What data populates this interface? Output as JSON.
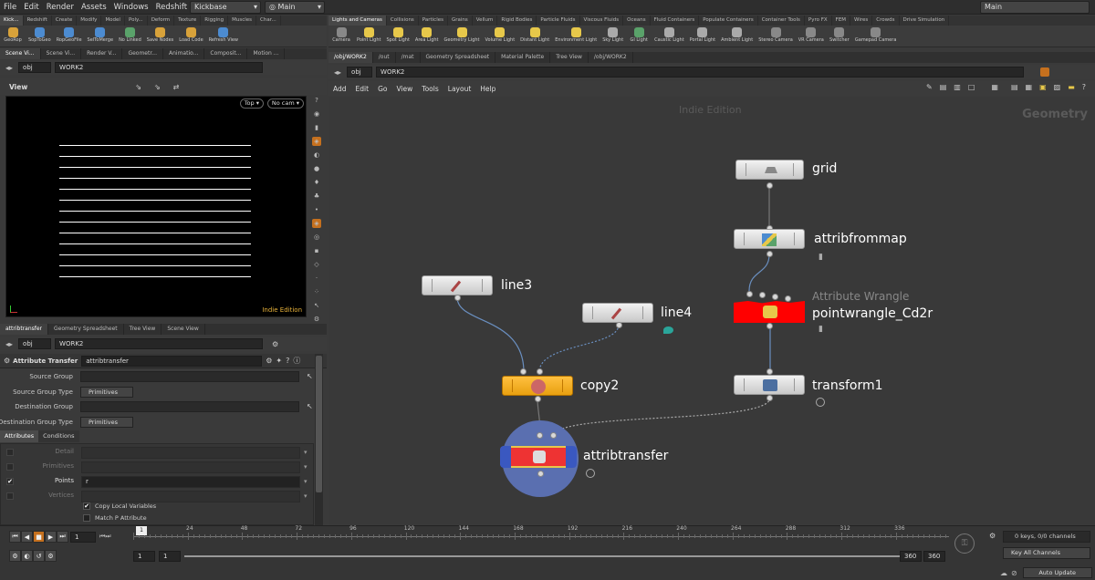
{
  "menu": [
    "File",
    "Edit",
    "Render",
    "Assets",
    "Windows",
    "Redshift",
    "Help"
  ],
  "desktop_left": "Kickbase",
  "desktop_right": "Main",
  "desktop_far": "Main",
  "shelf_left": {
    "tabs": [
      "Kick...",
      "Redshift",
      "Create",
      "Modify",
      "Model",
      "Poly...",
      "Deform",
      "Texture",
      "Rigging",
      "Muscles",
      "Char..."
    ],
    "tools": [
      {
        "label": "GeoRop",
        "color": "#d8a23a"
      },
      {
        "label": "SopToGeo",
        "color": "#4c8bd0"
      },
      {
        "label": "RopGeoFile",
        "color": "#4c8bd0"
      },
      {
        "label": "SelToMerge",
        "color": "#4c8bd0"
      },
      {
        "label": "No Linked",
        "color": "#5aa26a"
      },
      {
        "label": "Save Nodes",
        "color": "#d8a23a"
      },
      {
        "label": "Load Code",
        "color": "#d8a23a"
      },
      {
        "label": "Refresh View",
        "color": "#4c8bd0"
      }
    ]
  },
  "shelf_right": {
    "tabs": [
      "Lights and Cameras",
      "Collisions",
      "Particles",
      "Grains",
      "Vellum",
      "Rigid Bodies",
      "Particle Fluids",
      "Viscous Fluids",
      "Oceans",
      "Fluid Containers",
      "Populate Containers",
      "Container Tools",
      "Pyro FX",
      "FEM",
      "Wires",
      "Crowds",
      "Drive Simulation"
    ],
    "tools": [
      {
        "label": "Camera",
        "color": "#888"
      },
      {
        "label": "Point Light",
        "color": "#e7c84a"
      },
      {
        "label": "Spot Light",
        "color": "#e7c84a"
      },
      {
        "label": "Area Light",
        "color": "#e7c84a"
      },
      {
        "label": "Geometry Light",
        "color": "#e7c84a"
      },
      {
        "label": "Volume Light",
        "color": "#e7c84a"
      },
      {
        "label": "Distant Light",
        "color": "#e7c84a"
      },
      {
        "label": "Environment Light",
        "color": "#e7c84a"
      },
      {
        "label": "Sky Light",
        "color": "#aaa"
      },
      {
        "label": "GI Light",
        "color": "#5aa26a"
      },
      {
        "label": "Caustic Light",
        "color": "#aaa"
      },
      {
        "label": "Portal Light",
        "color": "#aaa"
      },
      {
        "label": "Ambient Light",
        "color": "#aaa"
      },
      {
        "label": "Stereo Camera",
        "color": "#888"
      },
      {
        "label": "VR Camera",
        "color": "#888"
      },
      {
        "label": "Switcher",
        "color": "#888"
      },
      {
        "label": "Gamepad Camera",
        "color": "#888"
      }
    ]
  },
  "viewer": {
    "tabs": [
      "Scene Vi...",
      "Scene Vi...",
      "Render V...",
      "Geometr...",
      "Animatio...",
      "Composit...",
      "Motion ..."
    ],
    "path_obj": "obj",
    "path_net": "WORK2",
    "title": "View",
    "view_mode": "Top",
    "camera": "No cam",
    "watermark": "Indie Edition",
    "lines": 13
  },
  "params": {
    "tabs": [
      "attribtransfer",
      "Geometry Spreadsheet",
      "Tree View",
      "Scene View"
    ],
    "path_obj": "obj",
    "path_net": "WORK2",
    "node_type": "Attribute Transfer",
    "node_name": "attribtransfer",
    "rows": [
      {
        "label": "Source Group",
        "value": ""
      },
      {
        "label": "Source Group Type",
        "value": "Primitives"
      },
      {
        "label": "Destination Group",
        "value": ""
      },
      {
        "label": "Destination Group Type",
        "value": "Primitives"
      }
    ],
    "subtabs": [
      "Attributes",
      "Conditions"
    ],
    "attribs": [
      {
        "label": "Detail",
        "value": "",
        "checked": false
      },
      {
        "label": "Primitives",
        "value": "",
        "checked": false
      },
      {
        "label": "Points",
        "value": "r",
        "checked": true
      },
      {
        "label": "Vertices",
        "value": "",
        "checked": false
      }
    ],
    "copy_local": "Copy Local Variables",
    "match_p": "Match P Attribute"
  },
  "network": {
    "tabs": [
      "/obj/WORK2",
      "/out",
      "/mat",
      "Geometry Spreadsheet",
      "Material Palette",
      "Tree View",
      "/obj/WORK2"
    ],
    "path_obj": "obj",
    "path_net": "WORK2",
    "menu": [
      "Add",
      "Edit",
      "Go",
      "View",
      "Tools",
      "Layout",
      "Help"
    ],
    "watermark": "Indie Edition",
    "context": "Geometry",
    "nodes": {
      "grid": "grid",
      "attribfrommap": "attribfrommap",
      "wrangle_type": "Attribute Wrangle",
      "wrangle": "pointwrangle_Cd2r",
      "transform": "transform1",
      "line3": "line3",
      "line4": "line4",
      "copy": "copy2",
      "attribtransfer": "attribtransfer"
    }
  },
  "timeline": {
    "frame": "1",
    "marker": "1",
    "ticks": [
      "24",
      "48",
      "72",
      "96",
      "120",
      "144",
      "168",
      "192",
      "216",
      "240",
      "264",
      "288",
      "312",
      "336"
    ],
    "start": "1",
    "start2": "1",
    "end": "360",
    "end2": "360",
    "keys": "0 keys, 0/0 channels",
    "key_all": "Key All Channels",
    "auto_update": "Auto Update"
  }
}
